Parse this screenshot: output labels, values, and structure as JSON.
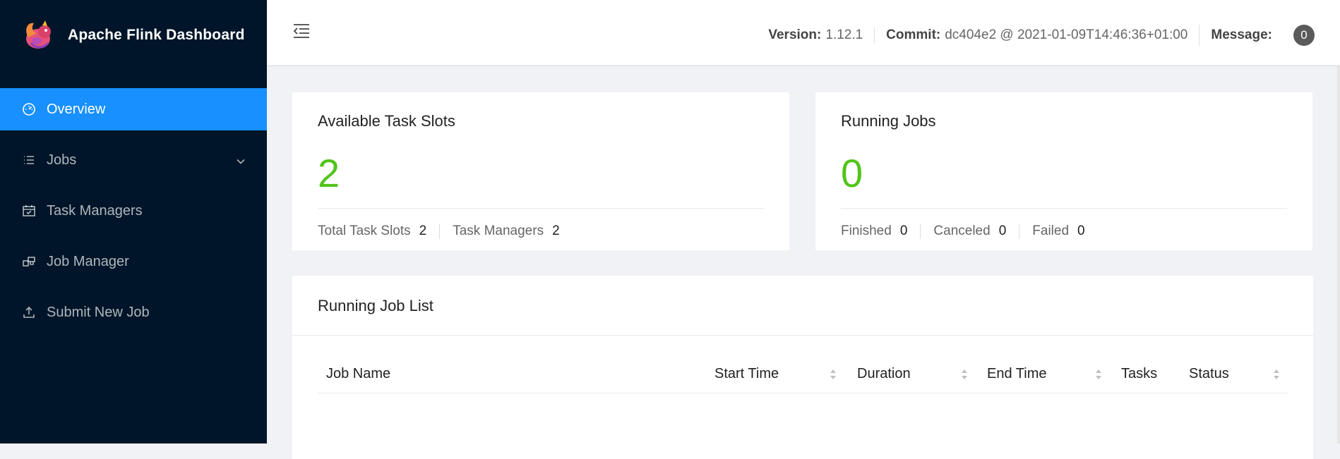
{
  "app": {
    "title": "Apache Flink Dashboard"
  },
  "sidebar": {
    "items": [
      {
        "label": "Overview",
        "icon": "dashboard-icon",
        "active": true
      },
      {
        "label": "Jobs",
        "icon": "list-icon",
        "has_submenu": true
      },
      {
        "label": "Task Managers",
        "icon": "schedule-icon"
      },
      {
        "label": "Job Manager",
        "icon": "build-icon"
      },
      {
        "label": "Submit New Job",
        "icon": "upload-icon"
      }
    ]
  },
  "header": {
    "version_label": "Version:",
    "version_value": "1.12.1",
    "commit_label": "Commit:",
    "commit_value": "dc404e2 @ 2021-01-09T14:46:36+01:00",
    "message_label": "Message:",
    "message_count": "0"
  },
  "task_slots": {
    "title": "Available Task Slots",
    "value": "2",
    "total_label": "Total Task Slots",
    "total_value": "2",
    "tm_label": "Task Managers",
    "tm_value": "2"
  },
  "running_jobs": {
    "title": "Running Jobs",
    "value": "0",
    "finished_label": "Finished",
    "finished_value": "0",
    "canceled_label": "Canceled",
    "canceled_value": "0",
    "failed_label": "Failed",
    "failed_value": "0"
  },
  "job_list": {
    "title": "Running Job List",
    "columns": [
      "Job Name",
      "Start Time",
      "Duration",
      "End Time",
      "Tasks",
      "Status"
    ]
  },
  "colors": {
    "sidebar_bg": "#001529",
    "active_item": "#1890ff",
    "stat_value": "#52c41a"
  }
}
